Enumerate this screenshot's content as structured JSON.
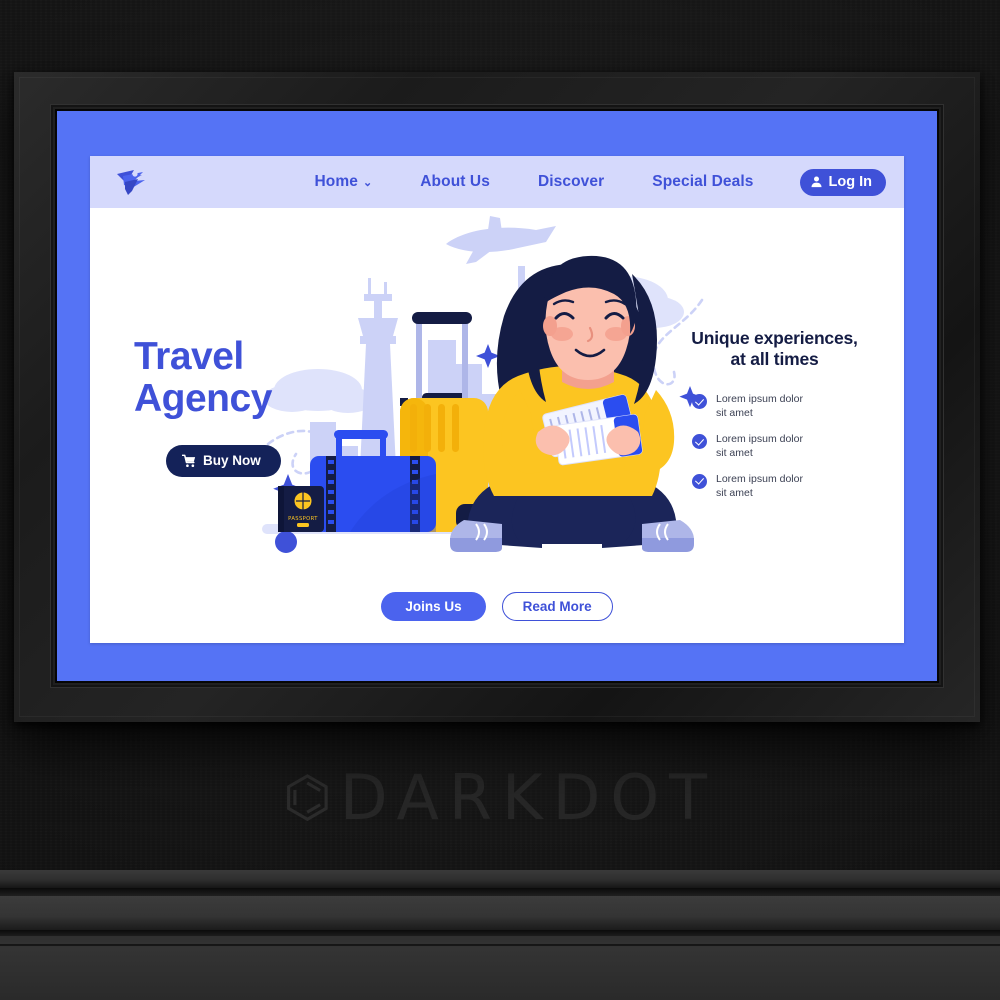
{
  "scene": {
    "wall_color": "#1a1a1a",
    "frame_color": "#1e1e1e",
    "mat_color": "#5573f5"
  },
  "watermark": {
    "mark": "⌬",
    "text": "DARKDOT"
  },
  "page": {
    "background": "#ffffff",
    "navbar": {
      "background": "#d5d9fc",
      "logo_name": "airplane-logo",
      "links": [
        {
          "label": "Home",
          "has_dropdown": true,
          "chevron": "⌄"
        },
        {
          "label": "About Us",
          "has_dropdown": false
        },
        {
          "label": "Discover",
          "has_dropdown": false
        },
        {
          "label": "Special Deals",
          "has_dropdown": false
        }
      ],
      "login": {
        "label": "Log In",
        "icon": "person-icon",
        "color": "#3f51d8"
      }
    },
    "hero": {
      "title": "Travel\nAgency",
      "title_color": "#3f51d8",
      "buy_button": {
        "label": "Buy Now",
        "icon": "cart-icon",
        "color": "#142259"
      },
      "subtitle": "Unique experiences,\nat all times",
      "subtitle_color": "#141c44",
      "features": [
        {
          "text": "Lorem ipsum dolor\nsit amet"
        },
        {
          "text": "Lorem ipsum dolor\nsit amet"
        },
        {
          "text": "Lorem ipsum dolor\nsit amet"
        }
      ],
      "check_color": "#3f51d8",
      "illustration": {
        "name": "traveler-woman-with-luggage",
        "passport_label": "PASSPORT",
        "accent_yellow": "#fcc521",
        "accent_blue": "#2b4df0",
        "accent_navy": "#1b2559"
      }
    },
    "ctas": [
      {
        "label": "Joins Us",
        "style": "filled",
        "color": "#4b63ee"
      },
      {
        "label": "Read More",
        "style": "outline",
        "color": "#3f51d8"
      }
    ]
  }
}
